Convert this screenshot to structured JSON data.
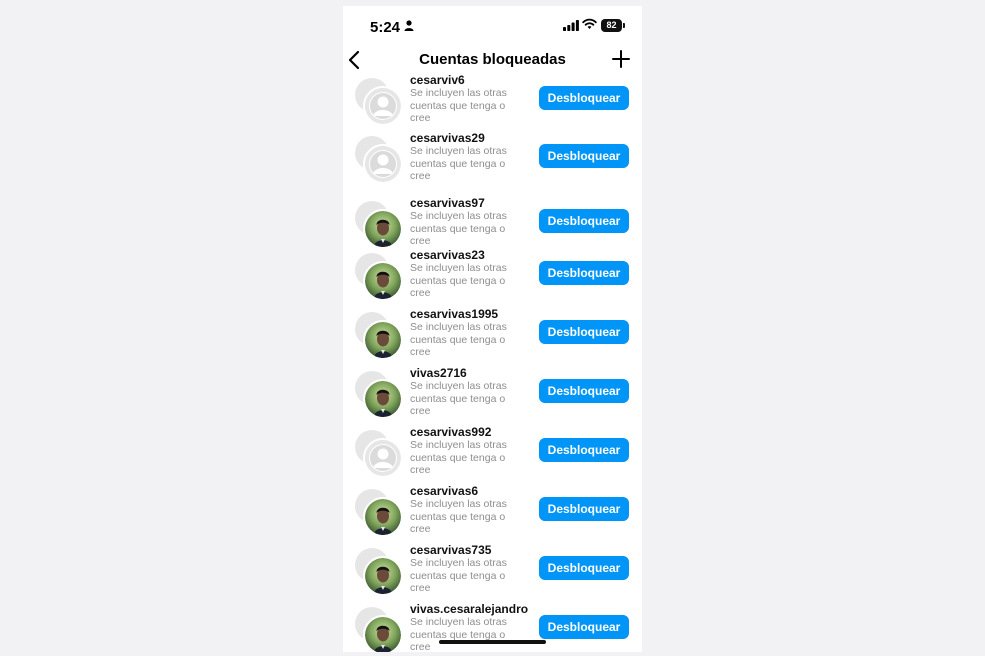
{
  "status_bar": {
    "time": "5:24",
    "battery": "82"
  },
  "header": {
    "title": "Cuentas bloqueadas"
  },
  "colors": {
    "button": "#0095f6",
    "subtext": "#8e8e8e"
  },
  "blocked_accounts": [
    {
      "username": "cesarviv6",
      "description": "Se incluyen las otras cuentas que tenga o cree",
      "avatar": "default-avatar",
      "button": "Desbloquear"
    },
    {
      "username": "cesarvivas29",
      "description": "Se incluyen las otras cuentas que tenga o cree",
      "avatar": "default-avatar",
      "button": "Desbloquear"
    },
    {
      "username": "cesarvivas97",
      "description": "Se incluyen las otras cuentas que tenga o cree",
      "avatar": "profile-photo",
      "button": "Desbloquear"
    },
    {
      "username": "cesarvivas23",
      "description": "Se incluyen las otras cuentas que tenga o cree",
      "avatar": "profile-photo",
      "button": "Desbloquear"
    },
    {
      "username": "cesarvivas1995",
      "description": "Se incluyen las otras cuentas que tenga o cree",
      "avatar": "profile-photo",
      "button": "Desbloquear"
    },
    {
      "username": "vivas2716",
      "description": "Se incluyen las otras cuentas que tenga o cree",
      "avatar": "profile-photo",
      "button": "Desbloquear"
    },
    {
      "username": "cesarvivas992",
      "description": "Se incluyen las otras cuentas que tenga o cree",
      "avatar": "default-avatar",
      "button": "Desbloquear"
    },
    {
      "username": "cesarvivas6",
      "description": "Se incluyen las otras cuentas que tenga o cree",
      "avatar": "profile-photo",
      "button": "Desbloquear"
    },
    {
      "username": "cesarvivas735",
      "description": "Se incluyen las otras cuentas que tenga o cree",
      "avatar": "profile-photo",
      "button": "Desbloquear"
    },
    {
      "username": "vivas.cesaralejandro",
      "description": "Se incluyen las otras cuentas que tenga o cree",
      "avatar": "profile-photo",
      "button": "Desbloquear"
    }
  ]
}
